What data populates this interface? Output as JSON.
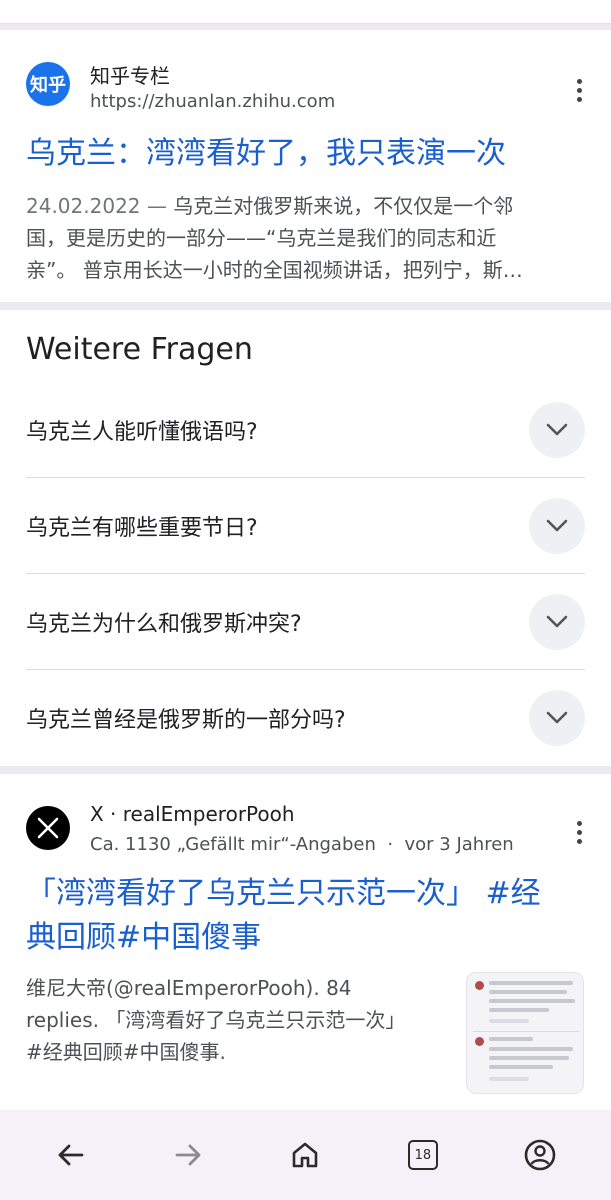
{
  "result1": {
    "source_name": "知乎专栏",
    "logo_text": "知乎",
    "url": "https://zhuanlan.zhihu.com",
    "title": "乌克兰：湾湾看好了，我只表演一次",
    "snippet_date": "24.02.2022",
    "snippet_sep": " — ",
    "snippet_line1": "乌克兰对俄罗斯来说，不仅仅是一个邻",
    "snippet_line2": "国，更是历史的一部分——“乌克兰是我们的同志和近",
    "snippet_line3": "亲”。 普京用长达一小时的全国视频讲话，把列宁，斯…",
    "menu_icon": "more-vert-icon"
  },
  "paa": {
    "heading": "Weitere Fragen",
    "questions": [
      "乌克兰人能听懂俄语吗?",
      "乌克兰有哪些重要节日?",
      "乌克兰为什么和俄罗斯冲突?",
      "乌克兰曾经是俄罗斯的一部分吗?"
    ]
  },
  "result2": {
    "source_line": "X · realEmperorPooh",
    "meta_line": "Ca. 1130 „Gefällt mir“-Angaben  ·  vor 3 Jahren",
    "title_line1": "「湾湾看好了乌克兰只示范一次」 #经",
    "title_line2": "典回顾#中国傻事",
    "snippet_line1": "维尼大帝(@realEmperorPooh). 84",
    "snippet_line2": "replies. 「湾湾看好了乌克兰只示范一次」",
    "snippet_line3": "#经典回顾#中国傻事."
  },
  "bottom_nav": {
    "tab_count": "18",
    "icons": [
      "back-arrow-icon",
      "forward-arrow-icon",
      "home-icon",
      "tabs-icon",
      "account-icon"
    ]
  },
  "colors": {
    "link": "#1a5fd0",
    "separator": "#eceaf0",
    "bottom_bar": "#f6f1f8"
  }
}
